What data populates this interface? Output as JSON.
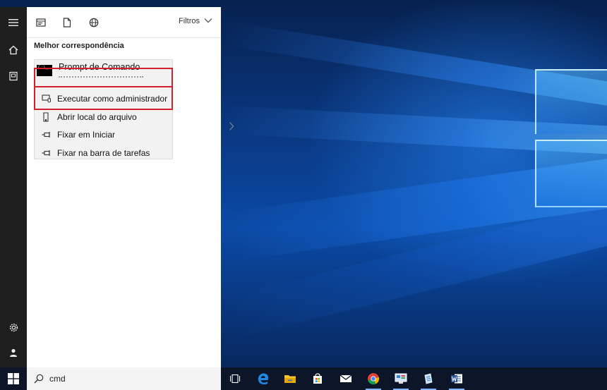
{
  "start_menu": {
    "rail": {
      "menu_icon": "hamburger-icon",
      "home_icon": "home-icon",
      "documents_icon": "document-icon",
      "settings_icon": "gear-icon",
      "user_icon": "user-icon"
    },
    "filter_bar": {
      "icons": [
        "apps-filter-icon",
        "documents-filter-icon",
        "web-filter-icon"
      ],
      "filters_label": "Filtros"
    },
    "section_title": "Melhor correspondência",
    "best_match": {
      "title": "Prompt de Comando",
      "thumbnail_text": "C:\\_"
    },
    "context_menu": [
      {
        "label": "Executar como administrador",
        "icon": "admin-shield-icon"
      },
      {
        "label": "Abrir local do arquivo",
        "icon": "folder-location-icon"
      },
      {
        "label": "Fixar em Iniciar",
        "icon": "pin-icon"
      },
      {
        "label": "Fixar na barra de tarefas",
        "icon": "pin-icon"
      }
    ],
    "highlight_color": "#d2202e"
  },
  "taskbar": {
    "search_value": "cmd",
    "apps": [
      "task-view-icon",
      "edge-icon",
      "file-explorer-icon",
      "store-icon",
      "mail-icon",
      "chrome-icon",
      "control-panel-icon",
      "notepad-icon",
      "word-icon"
    ]
  }
}
